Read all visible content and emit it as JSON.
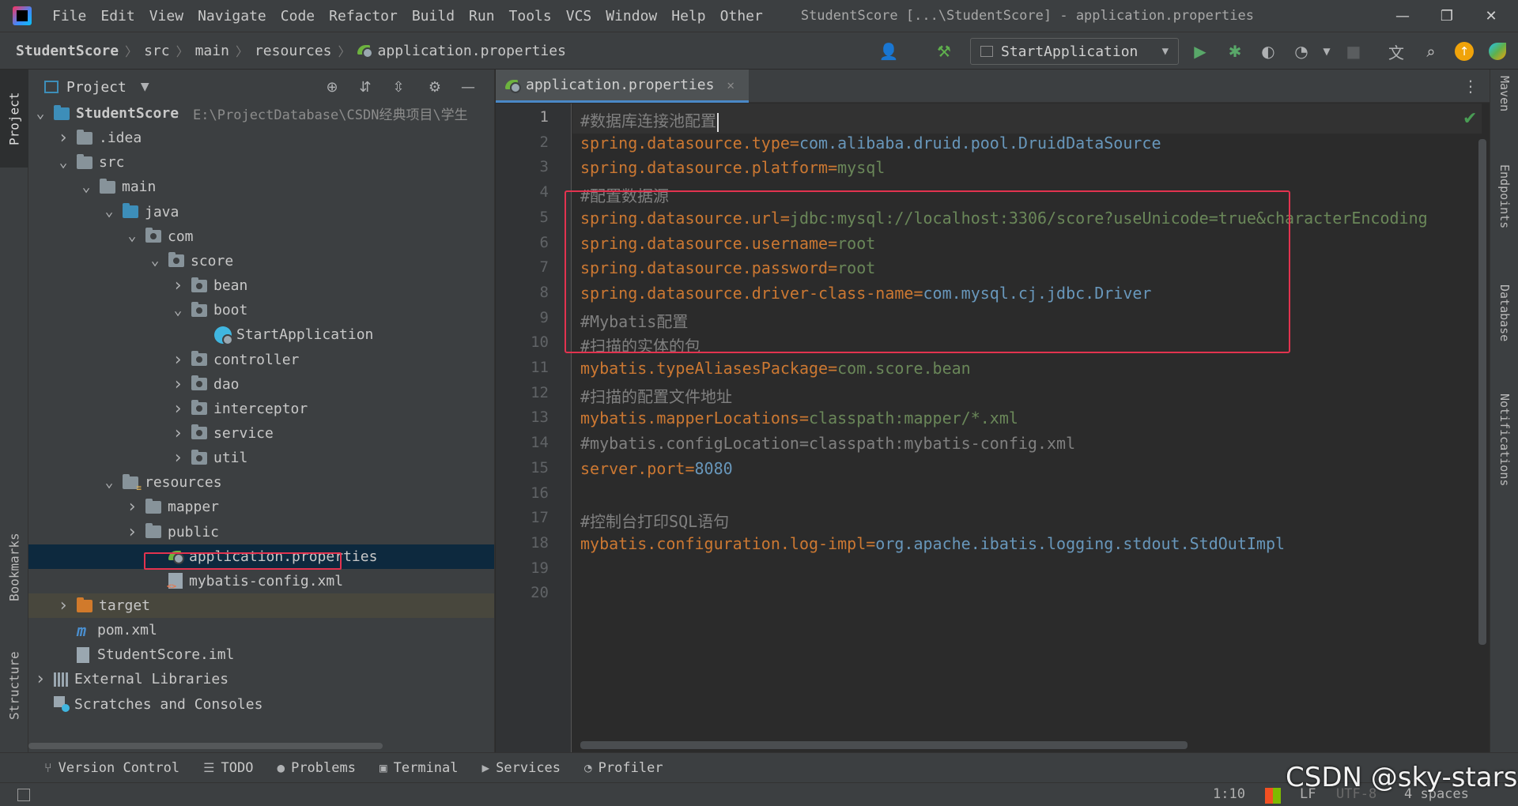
{
  "menu": [
    "File",
    "Edit",
    "View",
    "Navigate",
    "Code",
    "Refactor",
    "Build",
    "Run",
    "Tools",
    "VCS",
    "Window",
    "Help",
    "Other"
  ],
  "window_title": "StudentScore [...\\StudentScore] - application.properties",
  "window_controls": {
    "minimize": "—",
    "restore": "❐",
    "close": "✕"
  },
  "breadcrumb": [
    "StudentScore",
    "src",
    "main",
    "resources",
    "application.properties"
  ],
  "run_config": "StartApplication",
  "left_stripe": {
    "project": "Project",
    "bookmarks": "Bookmarks",
    "structure": "Structure"
  },
  "right_stripe": {
    "maven": "Maven",
    "endpoints": "Endpoints",
    "database": "Database",
    "notifications": "Notifications"
  },
  "project_panel": {
    "title": "Project",
    "tree": [
      {
        "label": "StudentScore",
        "path": "E:\\ProjectDatabase\\CSDN经典项目\\学生",
        "depth": 0,
        "icon": "module",
        "expanded": true
      },
      {
        "label": ".idea",
        "depth": 1,
        "icon": "folder",
        "expanded": false
      },
      {
        "label": "src",
        "depth": 1,
        "icon": "folder",
        "expanded": true
      },
      {
        "label": "main",
        "depth": 2,
        "icon": "folder",
        "expanded": true
      },
      {
        "label": "java",
        "depth": 3,
        "icon": "folder-blue",
        "expanded": true
      },
      {
        "label": "com",
        "depth": 4,
        "icon": "package",
        "expanded": true
      },
      {
        "label": "score",
        "depth": 5,
        "icon": "package",
        "expanded": true
      },
      {
        "label": "bean",
        "depth": 6,
        "icon": "package",
        "expanded": false
      },
      {
        "label": "boot",
        "depth": 6,
        "icon": "package",
        "expanded": true
      },
      {
        "label": "StartApplication",
        "depth": 7,
        "icon": "spring-app"
      },
      {
        "label": "controller",
        "depth": 6,
        "icon": "package",
        "expanded": false
      },
      {
        "label": "dao",
        "depth": 6,
        "icon": "package",
        "expanded": false
      },
      {
        "label": "interceptor",
        "depth": 6,
        "icon": "package",
        "expanded": false
      },
      {
        "label": "service",
        "depth": 6,
        "icon": "package",
        "expanded": false
      },
      {
        "label": "util",
        "depth": 6,
        "icon": "package",
        "expanded": false
      },
      {
        "label": "resources",
        "depth": 3,
        "icon": "folder-res",
        "expanded": true
      },
      {
        "label": "mapper",
        "depth": 4,
        "icon": "folder",
        "expanded": false
      },
      {
        "label": "public",
        "depth": 4,
        "icon": "folder",
        "expanded": false
      },
      {
        "label": "application.properties",
        "depth": 5,
        "icon": "spring-props",
        "selected": true
      },
      {
        "label": "mybatis-config.xml",
        "depth": 5,
        "icon": "xml"
      },
      {
        "label": "target",
        "depth": 1,
        "icon": "folder-orange",
        "expanded": false,
        "excluded": true
      },
      {
        "label": "pom.xml",
        "depth": 1,
        "icon": "maven"
      },
      {
        "label": "StudentScore.iml",
        "depth": 1,
        "icon": "iml"
      },
      {
        "label": "External Libraries",
        "depth": 0,
        "icon": "libraries",
        "expanded": false
      },
      {
        "label": "Scratches and Consoles",
        "depth": 0,
        "icon": "scratches"
      }
    ]
  },
  "editor": {
    "tab_label": "application.properties",
    "caret_line": 1,
    "lines": [
      [
        {
          "t": "#数据库连接池配置",
          "c": "comment"
        }
      ],
      [
        {
          "t": "spring.datasource.type",
          "c": "key"
        },
        {
          "t": "=",
          "c": "eq"
        },
        {
          "t": "com.alibaba.druid.pool.DruidDataSource",
          "c": "num"
        }
      ],
      [
        {
          "t": "spring.datasource.platform",
          "c": "key"
        },
        {
          "t": "=",
          "c": "eq"
        },
        {
          "t": "mysql",
          "c": "val"
        }
      ],
      [
        {
          "t": "#配置数据源",
          "c": "comment"
        }
      ],
      [
        {
          "t": "spring.datasource.url",
          "c": "key"
        },
        {
          "t": "=",
          "c": "eq"
        },
        {
          "t": "jdbc:mysql://localhost:3306/score?useUnicode=true&characterEncoding",
          "c": "val"
        }
      ],
      [
        {
          "t": "spring.datasource.username",
          "c": "key"
        },
        {
          "t": "=",
          "c": "eq"
        },
        {
          "t": "root",
          "c": "val"
        }
      ],
      [
        {
          "t": "spring.datasource.password",
          "c": "key"
        },
        {
          "t": "=",
          "c": "eq"
        },
        {
          "t": "root",
          "c": "val"
        }
      ],
      [
        {
          "t": "spring.datasource.driver-class-name",
          "c": "key"
        },
        {
          "t": "=",
          "c": "eq"
        },
        {
          "t": "com.mysql.cj.jdbc.Driver",
          "c": "num"
        }
      ],
      [
        {
          "t": "#Mybatis配置",
          "c": "comment"
        }
      ],
      [
        {
          "t": "#扫描的实体的包",
          "c": "comment"
        }
      ],
      [
        {
          "t": "mybatis.typeAliasesPackage",
          "c": "key"
        },
        {
          "t": "=",
          "c": "eq"
        },
        {
          "t": "com.score.bean",
          "c": "val"
        }
      ],
      [
        {
          "t": "#扫描的配置文件地址",
          "c": "comment"
        }
      ],
      [
        {
          "t": "mybatis.mapperLocations",
          "c": "key"
        },
        {
          "t": "=",
          "c": "eq"
        },
        {
          "t": "classpath:mapper/*.xml",
          "c": "val"
        }
      ],
      [
        {
          "t": "#mybatis.configLocation=classpath:mybatis-config.xml",
          "c": "comment"
        }
      ],
      [
        {
          "t": "server.port",
          "c": "key"
        },
        {
          "t": "=",
          "c": "eq"
        },
        {
          "t": "8080",
          "c": "num"
        }
      ],
      [],
      [
        {
          "t": "#控制台打印SQL语句",
          "c": "comment"
        }
      ],
      [
        {
          "t": "mybatis.configuration.log-impl",
          "c": "key"
        },
        {
          "t": "=",
          "c": "eq"
        },
        {
          "t": "org.apache.ibatis.logging.stdout.StdOutImpl",
          "c": "num"
        }
      ],
      [],
      []
    ]
  },
  "bottom_tools": [
    {
      "label": "Version Control",
      "icon": "branch-icon",
      "glyph": "⑂"
    },
    {
      "label": "TODO",
      "icon": "list-icon",
      "glyph": "☰"
    },
    {
      "label": "Problems",
      "icon": "warning-icon",
      "glyph": "●"
    },
    {
      "label": "Terminal",
      "icon": "terminal-icon",
      "glyph": "▣"
    },
    {
      "label": "Services",
      "icon": "services-icon",
      "glyph": "▶"
    },
    {
      "label": "Profiler",
      "icon": "profiler-icon",
      "glyph": "◔"
    }
  ],
  "status": {
    "position": "1:10",
    "line_sep": "LF",
    "encoding": "UTF-8",
    "indent": "4 spaces"
  },
  "watermark": "CSDN @sky-stars",
  "colors": {
    "key": "#cc7832",
    "value": "#6a8759",
    "number": "#6897bb",
    "comment": "#808080",
    "highlight": "#e2334f",
    "accent": "#4a88c7"
  }
}
